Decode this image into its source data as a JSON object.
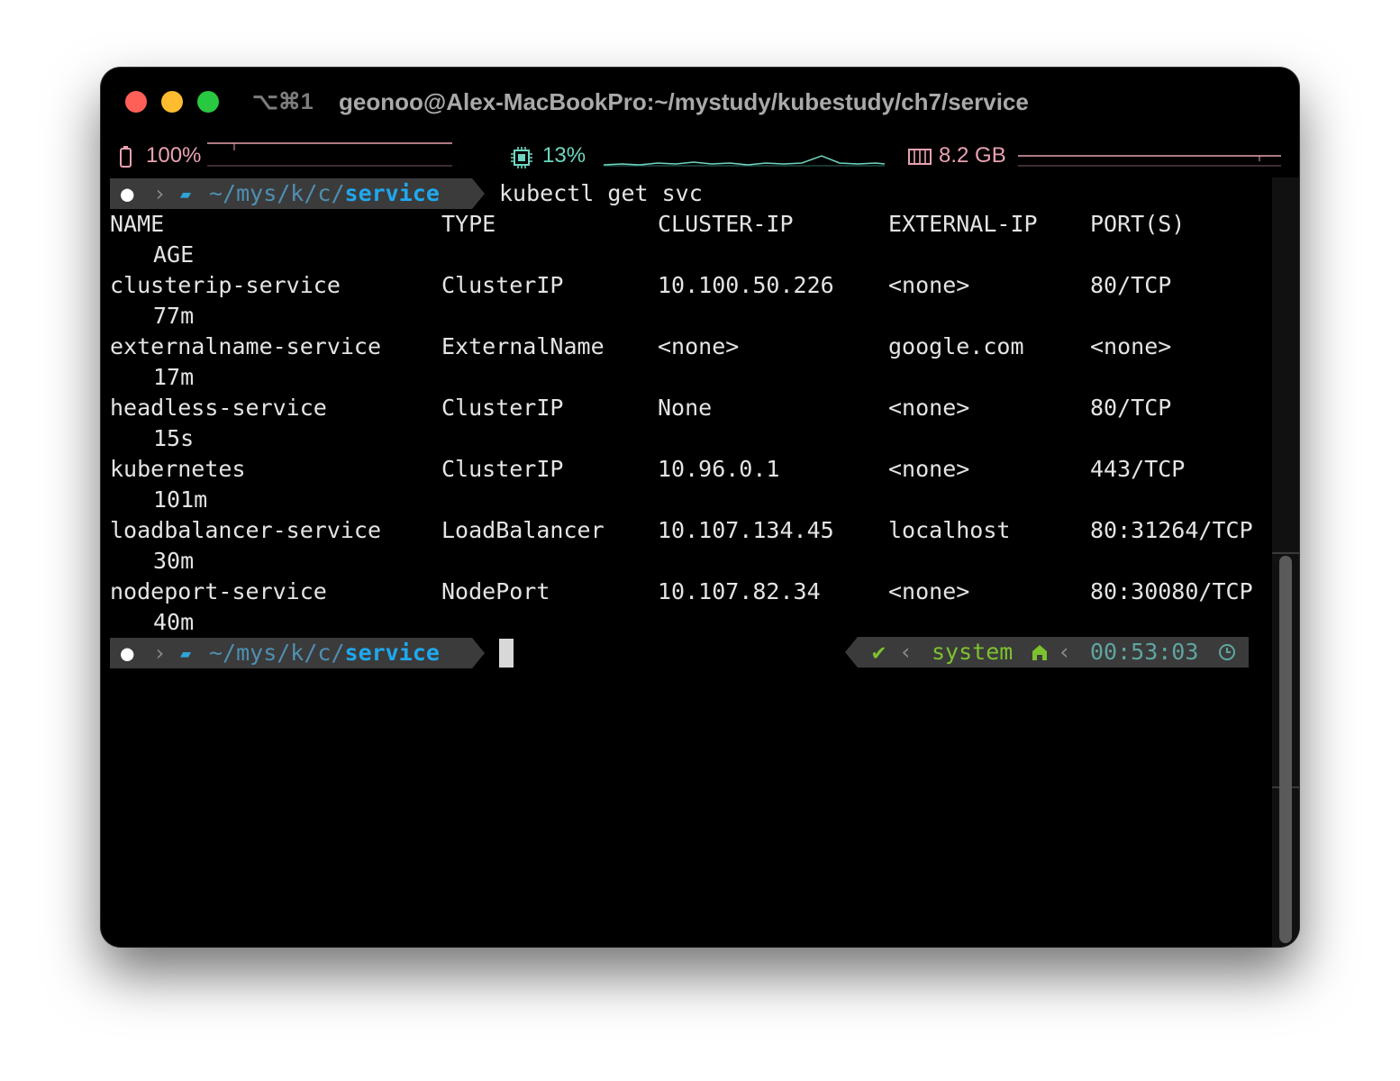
{
  "window": {
    "shortcut": "⌥⌘1",
    "title": "geonoo@Alex-MacBookPro:~/mystudy/kubestudy/ch7/service"
  },
  "status": {
    "battery": "100%",
    "cpu": "13%",
    "memory": "8.2 GB"
  },
  "prompt": {
    "path_dim": "~/mys/k/c/",
    "path_bold": "service",
    "command": "kubectl get svc"
  },
  "table": {
    "headers": [
      "NAME",
      "TYPE",
      "CLUSTER-IP",
      "EXTERNAL-IP",
      "PORT(S)",
      "AGE"
    ],
    "rows": [
      [
        "clusterip-service",
        "ClusterIP",
        "10.100.50.226",
        "<none>",
        "80/TCP",
        "77m"
      ],
      [
        "externalname-service",
        "ExternalName",
        "<none>",
        "google.com",
        "<none>",
        "17m"
      ],
      [
        "headless-service",
        "ClusterIP",
        "None",
        "<none>",
        "80/TCP",
        "15s"
      ],
      [
        "kubernetes",
        "ClusterIP",
        "10.96.0.1",
        "<none>",
        "443/TCP",
        "101m"
      ],
      [
        "loadbalancer-service",
        "LoadBalancer",
        "10.107.134.45",
        "localhost",
        "80:31264/TCP",
        "30m"
      ],
      [
        "nodeport-service",
        "NodePort",
        "10.107.82.34",
        "<none>",
        "80:30080/TCP",
        "40m"
      ]
    ]
  },
  "right_prompt": {
    "status_mark": "✔",
    "context": "system",
    "time": "00:53:03"
  },
  "colors": {
    "background": "#000000",
    "path_accent": "#1fa8ee",
    "context_green": "#7cc22e",
    "time_teal": "#5fa5a0",
    "status_pink": "#e9a2b1",
    "cpu_teal": "#6ed6c0"
  }
}
